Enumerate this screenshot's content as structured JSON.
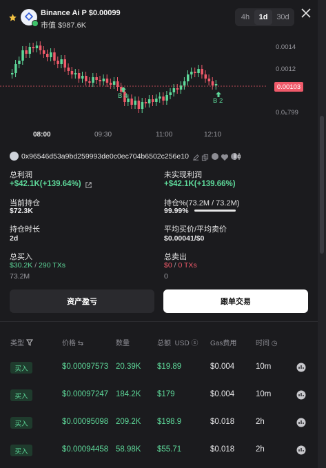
{
  "header": {
    "token_name": "Binance Ai P",
    "price": "$0.00099",
    "market_cap_label": "市值",
    "market_cap": "$987.6K",
    "timeframes": [
      "4h",
      "1d",
      "30d"
    ],
    "active_timeframe": "1d"
  },
  "chart": {
    "y_ticks": [
      "0.0014",
      "0.0012",
      "0.00103",
      "0.0₅799"
    ],
    "current_price_label": "0.00103",
    "x_ticks": [
      "08:00",
      "09:30",
      "11:00",
      "12:10"
    ],
    "markers": [
      {
        "label": "B 4"
      },
      {
        "label": "B 2"
      }
    ],
    "colors": {
      "up": "#5ed99a",
      "down": "#f05a6a"
    }
  },
  "wallet": {
    "address": "0x96546d53a9bd259993de0c0ec704b6502c256e10"
  },
  "stats": {
    "total_profit_label": "总利润",
    "total_profit_value": "+$42.1K(+139.64%)",
    "unrealized_label": "未实现利润",
    "unrealized_value": "+$42.1K(+139.66%)",
    "position_label": "当前持仓",
    "position_value": "$72.3K",
    "holding_pct_label": "持仓%(73.2M / 73.2M)",
    "holding_pct_value": "99.99%",
    "holding_pct_fraction": 0.9999,
    "duration_label": "持仓时长",
    "duration_value": "2d",
    "avg_price_label": "平均买价/平均卖价",
    "avg_price_value": "$0.00041/$0",
    "total_buy_label": "总买入",
    "total_buy_value": "$30.2K",
    "total_buy_sep": "/",
    "total_buy_txs": "290 TXs",
    "total_buy_amount": "73.2M",
    "total_sell_label": "总卖出",
    "total_sell_value": "$0",
    "total_sell_sep": "/",
    "total_sell_txs": "0 TXs",
    "total_sell_amount": "0"
  },
  "buttons": {
    "pnl": "资产盈亏",
    "copy_trade": "跟单交易"
  },
  "table": {
    "headers": {
      "type": "类型",
      "price": "价格",
      "qty": "数量",
      "total": "总额",
      "total_unit": "USD",
      "gas": "Gas费用",
      "time": "时间"
    },
    "rows": [
      {
        "type": "买入",
        "price": "$0.00097573",
        "qty": "20.39K",
        "total": "$19.89",
        "gas": "$0.004",
        "time": "10m"
      },
      {
        "type": "买入",
        "price": "$0.00097247",
        "qty": "184.2K",
        "total": "$179",
        "gas": "$0.004",
        "time": "10m"
      },
      {
        "type": "买入",
        "price": "$0.00095098",
        "qty": "209.2K",
        "total": "$198.9",
        "gas": "$0.018",
        "time": "2h"
      },
      {
        "type": "买入",
        "price": "$0.00094458",
        "qty": "58.98K",
        "total": "$55.71",
        "gas": "$0.018",
        "time": "2h"
      }
    ]
  }
}
